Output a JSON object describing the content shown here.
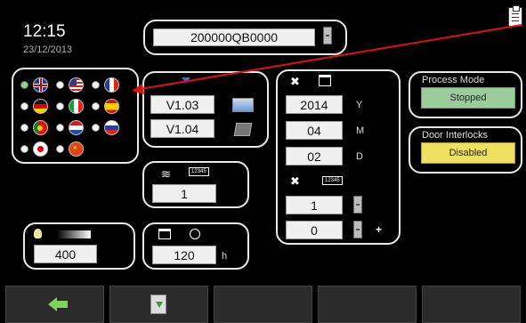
{
  "header": {
    "time": "12:15",
    "date": "23/12/2013"
  },
  "serial": {
    "value": "200000QB0000"
  },
  "firmware": {
    "primary_version": "V1.03",
    "secondary_version": "V1.04"
  },
  "date_panel": {
    "year": "2014",
    "year_unit": "Y",
    "month": "04",
    "month_unit": "M",
    "day": "02",
    "day_unit": "D",
    "counter_icon_text": "12345",
    "counter_value": "1",
    "counter_value_2": "0",
    "plus": "+"
  },
  "counter_panel": {
    "icon_text": "12345",
    "value": "1"
  },
  "brightness": {
    "value": "400"
  },
  "timer": {
    "value": "120",
    "unit": "h"
  },
  "process_mode": {
    "label": "Process Mode",
    "status": "Stopped",
    "color": "#9ccc9c"
  },
  "door_interlocks": {
    "label": "Door Interlocks",
    "status": "Disabled",
    "color": "#f0e060"
  },
  "languages": [
    {
      "flag": "uk-flag",
      "selected": true
    },
    {
      "flag": "us-flag",
      "selected": false
    },
    {
      "flag": "france-flag",
      "selected": false
    },
    {
      "flag": "germany-flag",
      "selected": false
    },
    {
      "flag": "italy-flag",
      "selected": false
    },
    {
      "flag": "spain-flag",
      "selected": false
    },
    {
      "flag": "portugal-flag",
      "selected": false
    },
    {
      "flag": "netherlands-flag",
      "selected": false
    },
    {
      "flag": "russia-flag",
      "selected": false
    },
    {
      "flag": "japan-flag",
      "selected": false
    },
    {
      "flag": "china-flag",
      "selected": false
    }
  ],
  "toolbar": {
    "back_icon": "arrow-left-icon",
    "save_icon": "save-download-icon"
  },
  "annotation": {
    "arrow_color": "#e01010"
  }
}
